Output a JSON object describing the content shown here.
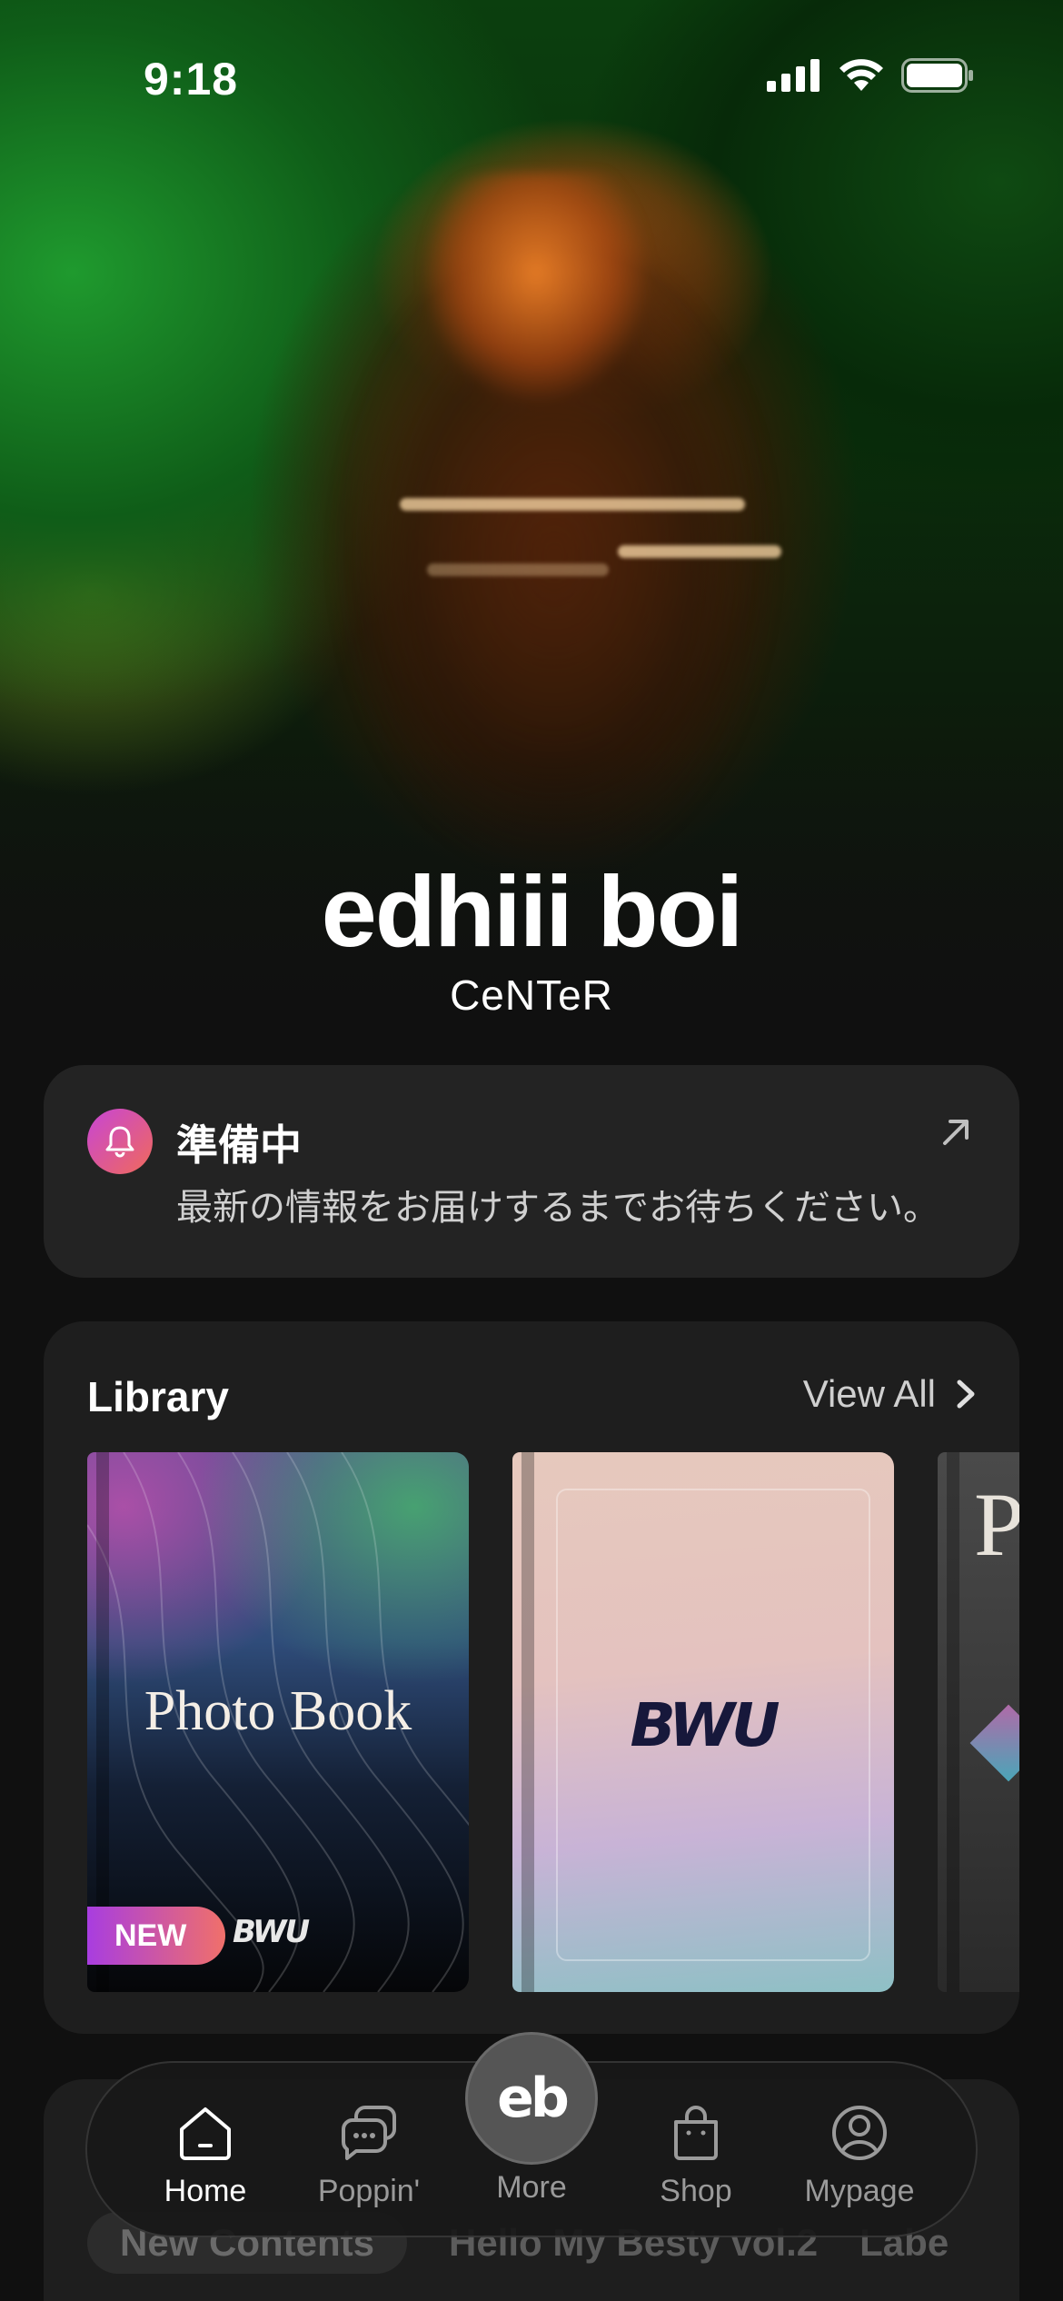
{
  "status_bar": {
    "time": "9:18"
  },
  "hero": {
    "artist_name": "edhiii boi",
    "group_name": "CeNTeR"
  },
  "notice": {
    "title": "準備中",
    "message": "最新の情報をお届けするまでお待ちください。"
  },
  "library": {
    "title": "Library",
    "view_all_label": "View All",
    "books": [
      {
        "cover_title": "Photo Book",
        "logo": "BWU",
        "badge": "NEW"
      },
      {
        "logo": "BWU"
      },
      {
        "cover_title": "P B"
      }
    ]
  },
  "content_tabs": [
    "New Contents",
    "Hello My Besty vol.2",
    "Labe"
  ],
  "tabbar": {
    "items": [
      {
        "label": "Home",
        "icon": "home-icon",
        "active": true
      },
      {
        "label": "Poppin'",
        "icon": "chat-bubbles-icon",
        "active": false
      },
      {
        "label": "More",
        "icon": "eb-logo-icon",
        "active": false
      },
      {
        "label": "Shop",
        "icon": "shopping-bag-icon",
        "active": false
      },
      {
        "label": "Mypage",
        "icon": "user-circle-icon",
        "active": false
      }
    ],
    "more_button_text": "eb"
  },
  "colors": {
    "background": "#101010",
    "card": "#232323",
    "badge_gradient_start": "#a83de0",
    "badge_gradient_end": "#f0706a",
    "hero_green": "#1f9a2e",
    "hero_orange": "#e07a1e"
  }
}
